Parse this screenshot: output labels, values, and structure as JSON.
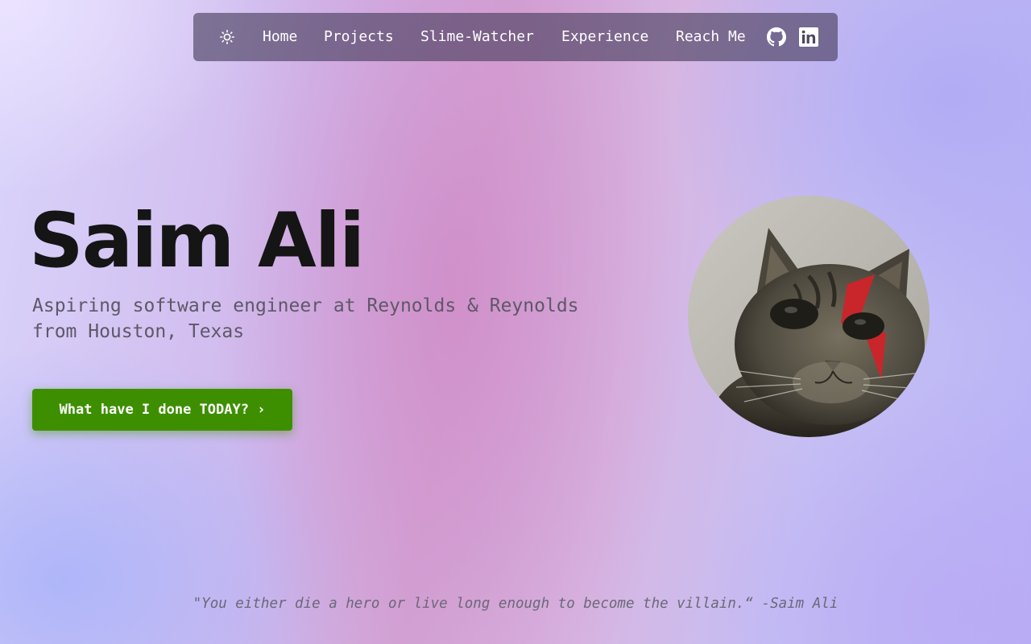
{
  "nav": {
    "theme_icon": "sun-icon",
    "links": [
      {
        "label": "Home"
      },
      {
        "label": "Projects"
      },
      {
        "label": "Slime-Watcher"
      },
      {
        "label": "Experience"
      },
      {
        "label": "Reach Me"
      }
    ],
    "social": [
      {
        "icon": "github-icon"
      },
      {
        "icon": "linkedin-icon"
      }
    ]
  },
  "hero": {
    "name": "Saim Ali",
    "tagline": "Aspiring software engineer at Reynolds & Reynolds from Houston, Texas",
    "cta_label": "What have I done TODAY? ›"
  },
  "quote": {
    "text": "\"You either die a hero or live long enough to become the villain.“ -Saim Ali"
  },
  "colors": {
    "cta_bg": "#3e8f00",
    "nav_bg": "rgba(70,60,90,0.62)",
    "heading": "#151515",
    "tagline": "#5e5868"
  }
}
